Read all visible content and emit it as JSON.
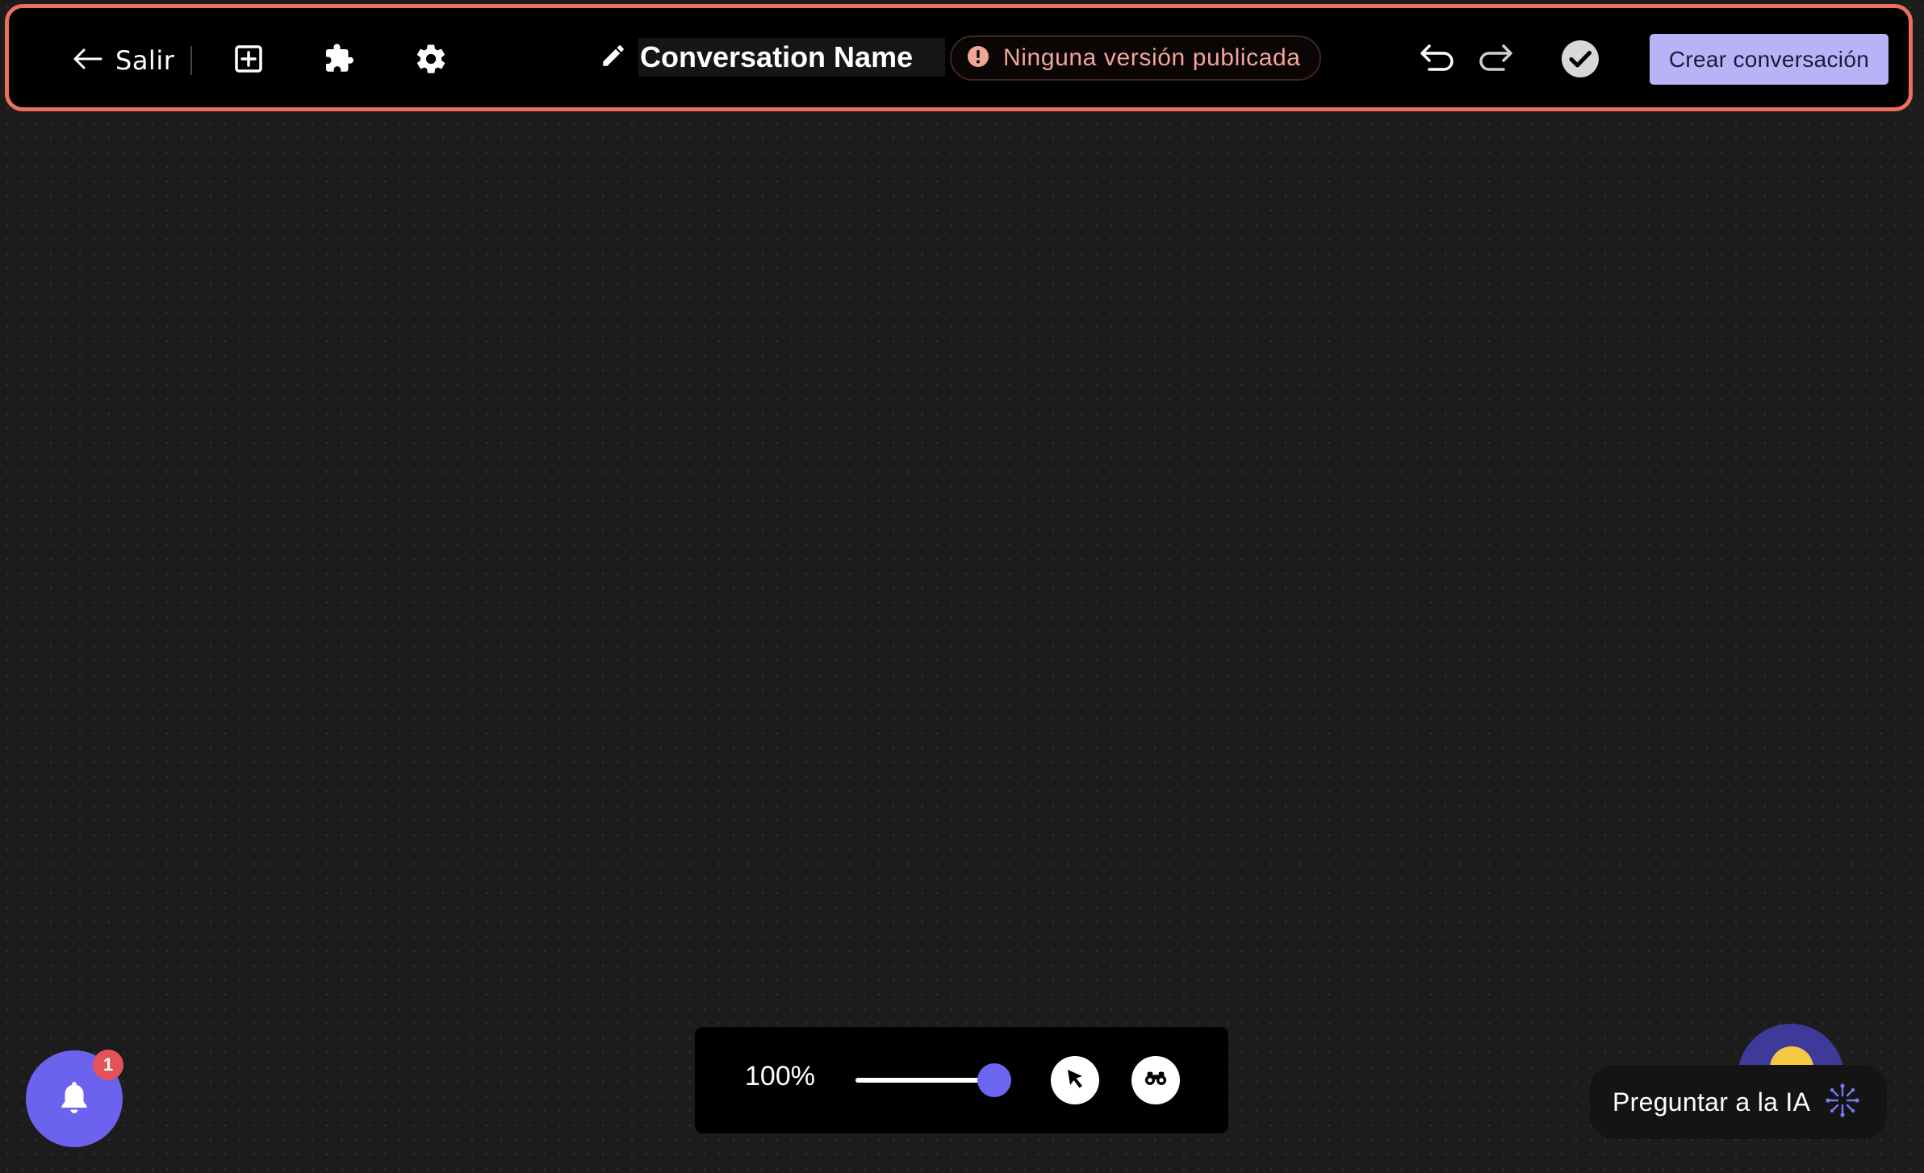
{
  "header": {
    "exit_label": "Salir",
    "conversation_name": "Conversation Name",
    "status_text": "Ninguna versión publicada",
    "create_button_label": "Crear conversación"
  },
  "toolbar": {
    "zoom_level": "100%",
    "zoom_slider_value": 1.0
  },
  "notifications": {
    "badge_count": "1"
  },
  "ask_ai": {
    "label": "Preguntar a la IA"
  },
  "colors": {
    "accent": "#6c65f1",
    "create_button_bg": "#b9b2f7",
    "status_text": "#f1a597",
    "highlight_border": "#ec6e5e",
    "badge": "#e5535a"
  },
  "icons": {
    "exit": "arrow-left-icon",
    "add": "add-box-icon",
    "plugins": "puzzle-icon",
    "settings": "gear-icon",
    "edit": "pencil-icon",
    "status": "alert-circle-icon",
    "undo": "undo-icon",
    "redo": "redo-icon",
    "validate": "check-circle-icon",
    "select_tool": "cursor-icon",
    "search_tool": "binoculars-icon",
    "notifications": "bell-icon",
    "ai": "sparkle-icon"
  }
}
